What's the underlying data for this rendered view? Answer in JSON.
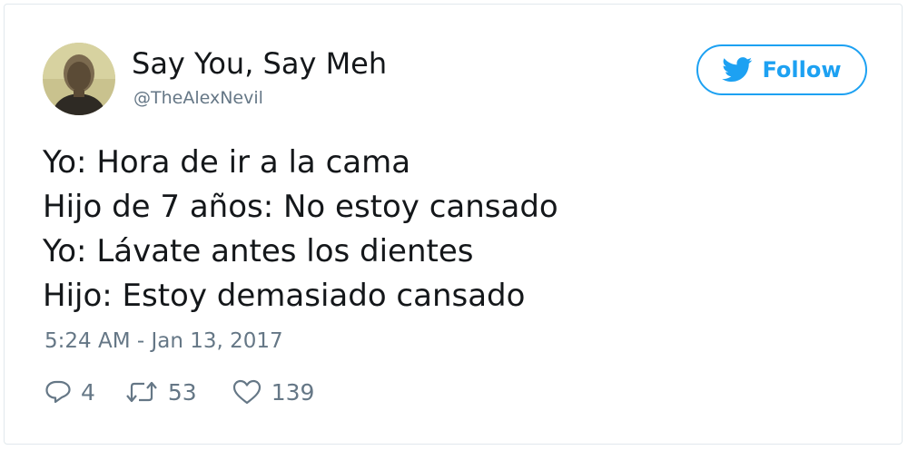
{
  "tweet": {
    "author": {
      "display_name": "Say You, Say Meh",
      "handle": "@TheAlexNevil"
    },
    "follow_label": "Follow",
    "lines": [
      "Yo: Hora de ir a la cama",
      "Hijo de 7 años: No estoy cansado",
      "Yo: Lávate antes los dientes",
      "Hijo: Estoy demasiado cansado"
    ],
    "timestamp": "5:24 AM - Jan 13, 2017",
    "stats": {
      "replies": "4",
      "retweets": "53",
      "likes": "139"
    }
  },
  "colors": {
    "accent": "#1da1f2",
    "text": "#14171a",
    "muted": "#657786",
    "border": "#e1e8ed"
  },
  "icons": {
    "follow": "twitter-bird-icon",
    "reply": "reply-icon",
    "retweet": "retweet-icon",
    "like": "heart-icon"
  }
}
